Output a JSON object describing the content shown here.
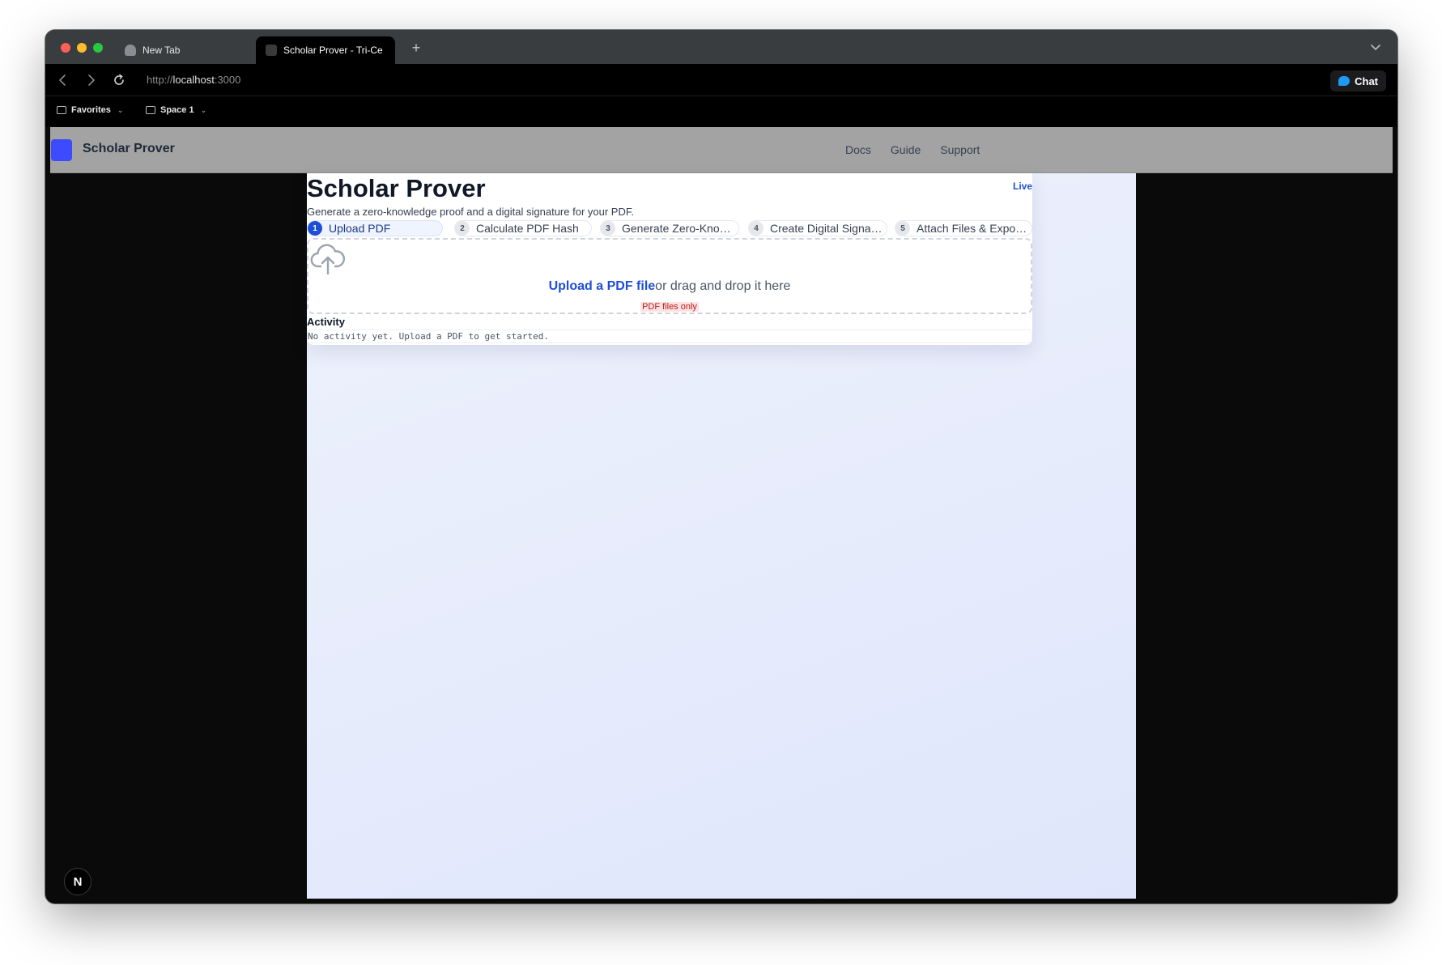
{
  "browser": {
    "tabs": [
      {
        "title": "New Tab"
      },
      {
        "title": "Scholar Prover - Tri-Ce"
      }
    ],
    "new_tab": "+",
    "address": {
      "scheme": "http://",
      "host": "localhost",
      "port": ":3000"
    },
    "chat_label": "Chat",
    "bookmarks": [
      {
        "label": "Favorites"
      },
      {
        "label": "Space 1"
      }
    ]
  },
  "site": {
    "name": "Scholar Prover",
    "nav": [
      "Docs",
      "Guide",
      "Support"
    ]
  },
  "card": {
    "title": "Scholar Prover",
    "status": "Live",
    "subtitle": "Generate a zero-knowledge proof and a digital signature for your PDF.",
    "steps": [
      {
        "num": "1",
        "label": "Upload PDF"
      },
      {
        "num": "2",
        "label": "Calculate PDF Hash"
      },
      {
        "num": "3",
        "label": "Generate Zero-Knowl..."
      },
      {
        "num": "4",
        "label": "Create Digital Signat..."
      },
      {
        "num": "5",
        "label": "Attach Files & Export..."
      }
    ],
    "dropzone": {
      "link": "Upload a PDF file",
      "text": "or drag and drop it here",
      "hint": "PDF files only"
    },
    "activity": {
      "title": "Activity",
      "empty": "No activity yet. Upload a PDF to get started."
    }
  },
  "nextjs_badge": "N",
  "colors": {
    "accent": "#1d4ed8",
    "logo": "#3d4bff",
    "header_bg": "#a3a3a3",
    "hint_bg": "#fde2e2",
    "hint_text": "#b91c1c"
  }
}
